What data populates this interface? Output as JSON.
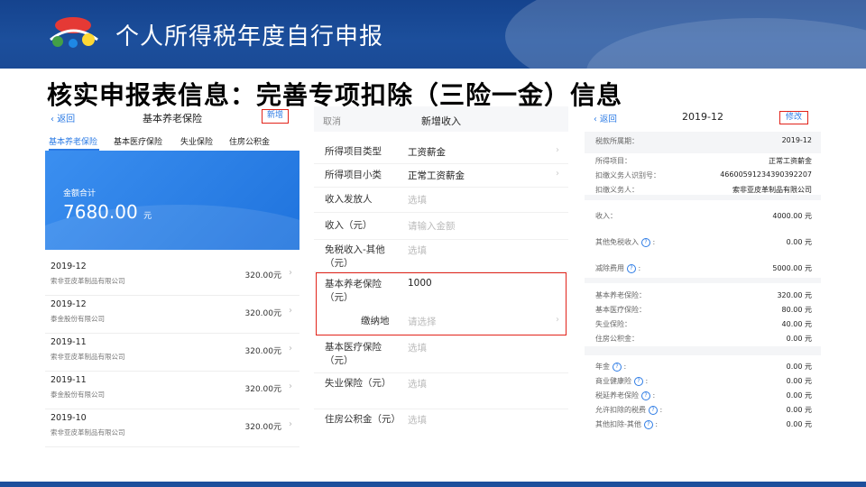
{
  "header": {
    "title": "个人所得税年度自行申报"
  },
  "subtitle": "核实申报表信息：完善专项扣除（三险一金）信息",
  "panel1": {
    "back": "返回",
    "title": "基本养老保险",
    "add_button": "新增",
    "tabs": [
      "基本养老保险",
      "基本医疗保险",
      "失业保险",
      "住房公积金"
    ],
    "total_label": "金额合计",
    "total_value": "7680.00",
    "total_unit": "元",
    "records": [
      {
        "date": "2019-12",
        "company": "索非亚皮革制品有限公司",
        "amount": "320.00元"
      },
      {
        "date": "2019-12",
        "company": "泰金股份有限公司",
        "amount": "320.00元"
      },
      {
        "date": "2019-11",
        "company": "索非亚皮革制品有限公司",
        "amount": "320.00元"
      },
      {
        "date": "2019-11",
        "company": "泰金股份有限公司",
        "amount": "320.00元"
      },
      {
        "date": "2019-10",
        "company": "索非亚皮革制品有限公司",
        "amount": "320.00元"
      }
    ]
  },
  "panel2": {
    "cancel": "取消",
    "title": "新增收入",
    "fields": [
      {
        "label": "所得项目类型",
        "value": "工资薪金",
        "placeholder": false
      },
      {
        "label": "所得项目小类",
        "value": "正常工资薪金",
        "placeholder": false
      },
      {
        "label": "收入发放人",
        "value": "选填",
        "placeholder": true
      },
      {
        "label": "收入（元）",
        "value": "请输入金额",
        "placeholder": true
      },
      {
        "label": "免税收入-其他（元）",
        "value": "选填",
        "placeholder": true
      },
      {
        "label": "基本养老保险（元）",
        "value": "1000",
        "placeholder": false
      },
      {
        "label": "缴纳地",
        "value": "请选择",
        "placeholder": true
      },
      {
        "label": "基本医疗保险（元）",
        "value": "选填",
        "placeholder": true
      },
      {
        "label": "失业保险（元）",
        "value": "选填",
        "placeholder": true
      },
      {
        "label": "住房公积金（元）",
        "value": "选填",
        "placeholder": true
      }
    ]
  },
  "panel3": {
    "back": "返回",
    "title": "2019-12",
    "edit_button": "修改",
    "rows": [
      {
        "label": "税款所属期：",
        "value": "2019-12"
      },
      {
        "label": "所得项目：",
        "value": "正常工资薪金"
      },
      {
        "label": "扣缴义务人识别号：",
        "value": "46600591234390392207"
      },
      {
        "label": "扣缴义务人：",
        "value": "索非亚皮革制品有限公司"
      },
      {
        "label": "收入：",
        "value": "4000.00 元"
      },
      {
        "label": "其他免税收入",
        "value": "0.00 元"
      },
      {
        "label": "减除费用",
        "value": "5000.00 元"
      },
      {
        "label": "基本养老保险：",
        "value": "320.00 元"
      },
      {
        "label": "基本医疗保险：",
        "value": "80.00 元"
      },
      {
        "label": "失业保险：",
        "value": "40.00 元"
      },
      {
        "label": "住房公积金：",
        "value": "0.00 元"
      },
      {
        "label": "年金",
        "value": "0.00 元"
      },
      {
        "label": "商业健康险",
        "value": "0.00 元"
      },
      {
        "label": "税延养老保险",
        "value": "0.00 元"
      },
      {
        "label": "允许扣除的税费",
        "value": "0.00 元"
      },
      {
        "label": "其他扣除-其他",
        "value": "0.00 元"
      }
    ]
  }
}
